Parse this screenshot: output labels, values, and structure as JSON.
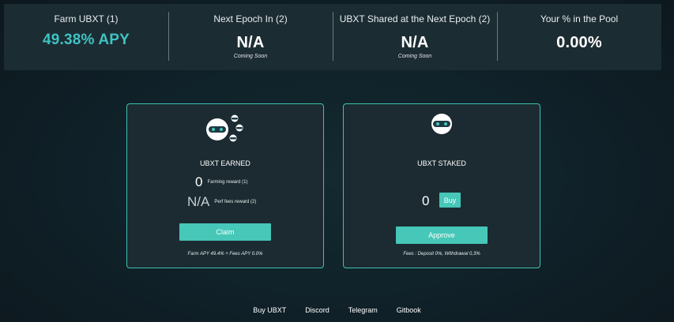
{
  "stats": [
    {
      "label": "Farm UBXT (1)",
      "value": "49.38% APY",
      "sub": ""
    },
    {
      "label": "Next Epoch In (2)",
      "value": "N/A",
      "sub": "Coming Soon"
    },
    {
      "label": "UBXT Shared at the Next Epoch (2)",
      "value": "N/A",
      "sub": "Coming Soon"
    },
    {
      "label": "Your % in the Pool",
      "value": "0.00%",
      "sub": ""
    }
  ],
  "earned_card": {
    "title": "UBXT EARNED",
    "farming_value": "0",
    "farming_label": "Farming reward (1)",
    "perf_value": "N/A",
    "perf_label": "Perf fees reward (2)",
    "claim_label": "Claim",
    "note": "Farm APY 49.4% + Fees APY 0.0%",
    "icon": "robot-mascot-with-coins-icon"
  },
  "staked_card": {
    "title": "UBXT STAKED",
    "staked_value": "0",
    "buy_label": "Buy",
    "approve_label": "Approve",
    "note": "Fees : Deposit 0%, Withdrawal 0,3%",
    "icon": "robot-mascot-icon"
  },
  "footer": {
    "links": [
      "Buy UBXT",
      "Discord",
      "Telegram",
      "Gitbook"
    ]
  },
  "colors": {
    "accent": "#3fc3c3",
    "button": "#46c7b8",
    "card_border": "#3fc0b0"
  }
}
